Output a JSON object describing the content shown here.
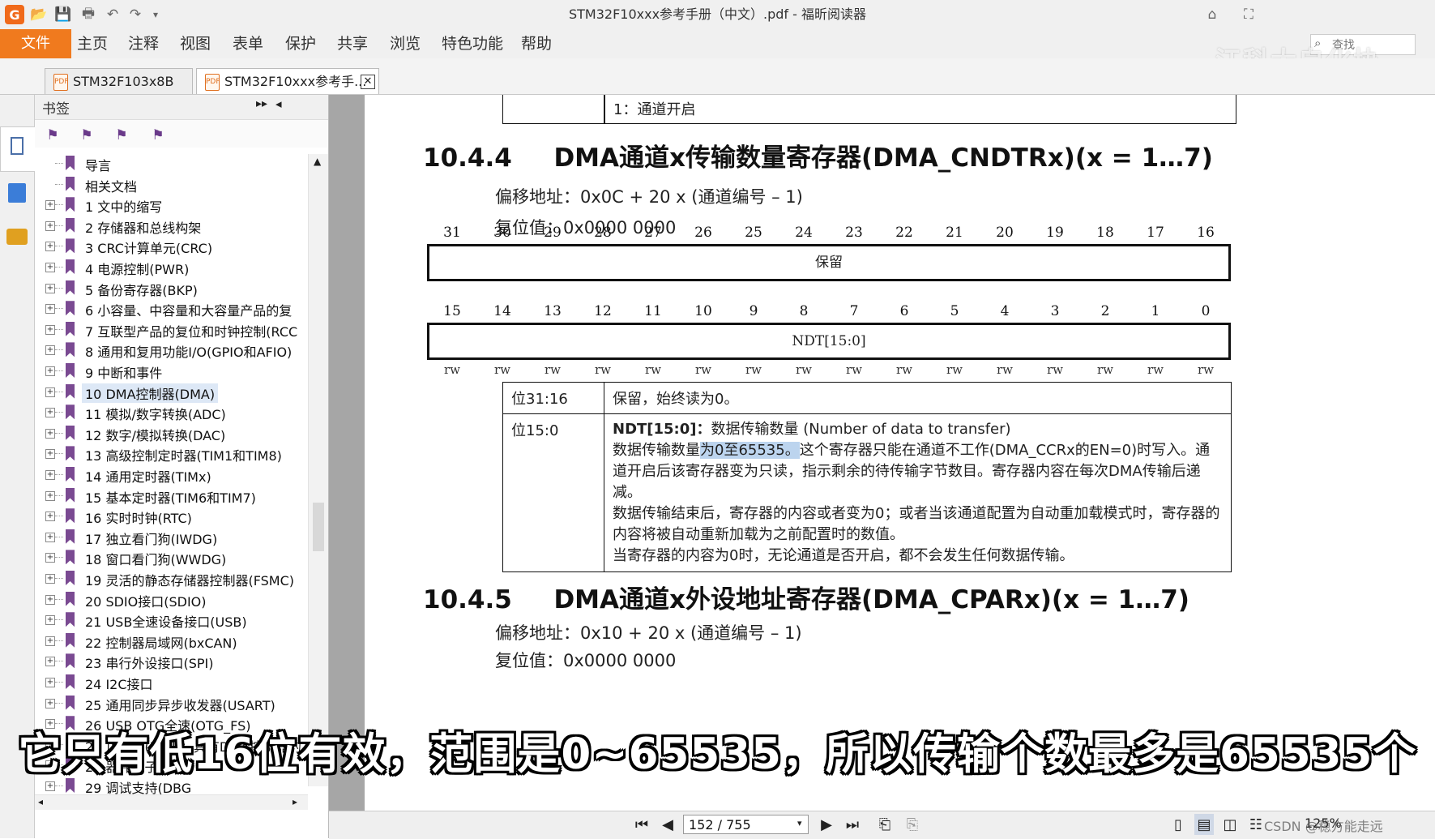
{
  "window": {
    "title": "STM32F10xxx参考手册（中文）.pdf - 福昕阅读器"
  },
  "menu": {
    "file": "文件",
    "items": [
      "主页",
      "注释",
      "视图",
      "表单",
      "保护",
      "共享",
      "浏览",
      "特色功能",
      "帮助"
    ],
    "search_placeholder": "查找"
  },
  "watermark": "江科大自化协",
  "tabs": [
    {
      "label": "STM32F103x8B数...",
      "active": false
    },
    {
      "label": "STM32F10xxx参考手...",
      "active": true
    }
  ],
  "bookmarks": {
    "title": "书签",
    "items": [
      {
        "label": "导言",
        "expandable": false
      },
      {
        "label": "相关文档",
        "expandable": false
      },
      {
        "label": "1 文中的缩写",
        "expandable": true
      },
      {
        "label": "2 存储器和总线构架",
        "expandable": true
      },
      {
        "label": "3 CRC计算单元(CRC)",
        "expandable": true
      },
      {
        "label": "4 电源控制(PWR)",
        "expandable": true
      },
      {
        "label": "5 备份寄存器(BKP)",
        "expandable": true
      },
      {
        "label": "6 小容量、中容量和大容量产品的复",
        "expandable": true
      },
      {
        "label": "7 互联型产品的复位和时钟控制(RCC",
        "expandable": true
      },
      {
        "label": "8 通用和复用功能I/O(GPIO和AFIO)",
        "expandable": true
      },
      {
        "label": "9 中断和事件",
        "expandable": true
      },
      {
        "label": "10 DMA控制器(DMA)",
        "expandable": true,
        "selected": true
      },
      {
        "label": "11 模拟/数字转换(ADC)",
        "expandable": true
      },
      {
        "label": "12 数字/模拟转换(DAC)",
        "expandable": true
      },
      {
        "label": "13 高级控制定时器(TIM1和TIM8)",
        "expandable": true
      },
      {
        "label": "14 通用定时器(TIMx)",
        "expandable": true
      },
      {
        "label": "15 基本定时器(TIM6和TIM7)",
        "expandable": true
      },
      {
        "label": "16 实时时钟(RTC)",
        "expandable": true
      },
      {
        "label": "17 独立看门狗(IWDG)",
        "expandable": true
      },
      {
        "label": "18 窗口看门狗(WWDG)",
        "expandable": true
      },
      {
        "label": "19 灵活的静态存储器控制器(FSMC)",
        "expandable": true
      },
      {
        "label": "20 SDIO接口(SDIO)",
        "expandable": true
      },
      {
        "label": "21 USB全速设备接口(USB)",
        "expandable": true
      },
      {
        "label": "22 控制器局域网(bxCAN)",
        "expandable": true
      },
      {
        "label": "23 串行外设接口(SPI)",
        "expandable": true
      },
      {
        "label": "24 I2C接口",
        "expandable": true
      },
      {
        "label": "25 通用同步异步收发器(USART)",
        "expandable": true
      },
      {
        "label": "26 USB OTG全速(OTG_FS)",
        "expandable": true
      },
      {
        "label": "27 以太网(ETH)：具有DMA控制器的",
        "expandable": true
      },
      {
        "label": "28 器件电子签名",
        "expandable": true
      },
      {
        "label": "29 调试支持(DBG",
        "expandable": true
      }
    ]
  },
  "document": {
    "prev_table_row": "1：通道开启",
    "section1": {
      "number": "10.4.4",
      "title": "DMA通道x传输数量寄存器(DMA_CNDTRx)(x = 1…7)",
      "offset": "偏移地址：0x0C + 20 x (通道编号 – 1)",
      "reset": "复位值：0x0000 0000",
      "bits_high": [
        "31",
        "30",
        "29",
        "28",
        "27",
        "26",
        "25",
        "24",
        "23",
        "22",
        "21",
        "20",
        "19",
        "18",
        "17",
        "16"
      ],
      "bits_low": [
        "15",
        "14",
        "13",
        "12",
        "11",
        "10",
        "9",
        "8",
        "7",
        "6",
        "5",
        "4",
        "3",
        "2",
        "1",
        "0"
      ],
      "reserved_label": "保留",
      "ndt_label": "NDT[15:0]",
      "rw": "rw",
      "rows": [
        {
          "bits": "位31:16",
          "text": "保留，始终读为0。"
        },
        {
          "bits": "位15:0",
          "name": "NDT[15:0]：",
          "name_desc": "数据传输数量 (Number of data to transfer)",
          "p1_pre": "数据传输数量",
          "p1_hl": "为0至65535。",
          "p1_post": "这个寄存器只能在通道不工作(DMA_CCRx的EN=0)时写入。通道开启后该寄存器变为只读，指示剩余的待传输字节数目。寄存器内容在每次DMA传输后递减。",
          "p2": "数据传输结束后，寄存器的内容或者变为0；或者当该通道配置为自动重加载模式时，寄存器的内容将被自动重新加载为之前配置时的数值。",
          "p3": "当寄存器的内容为0时，无论通道是否开启，都不会发生任何数据传输。"
        }
      ]
    },
    "section2": {
      "number": "10.4.5",
      "title": "DMA通道x外设地址寄存器(DMA_CPARx)(x = 1…7)",
      "offset": "偏移地址：0x10 + 20 x (通道编号 – 1)",
      "reset": "复位值：0x0000 0000"
    }
  },
  "statusbar": {
    "page": "152 / 755",
    "zoom": "125%",
    "credit": "CSDN @稳方能走远"
  },
  "subtitle": "它只有低16位有效，范围是0~65535，所以传输个数最多是65535个"
}
